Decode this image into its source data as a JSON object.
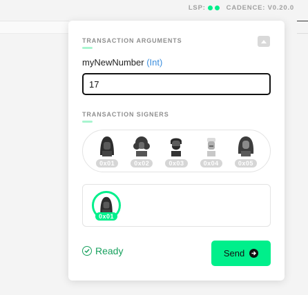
{
  "statusbar": {
    "lsp_label": "LSP:",
    "lsp_dots": [
      "#00ef8b",
      "#00ef8b"
    ],
    "version": "CADENCE: V0.20.0"
  },
  "arguments": {
    "title": "TRANSACTION ARGUMENTS",
    "param_name": "myNewNumber",
    "param_type": "(Int)",
    "value": "17"
  },
  "signers": {
    "title": "TRANSACTION SIGNERS",
    "accounts": [
      {
        "address": "0x01",
        "icon": "dark-hair-avatar-icon"
      },
      {
        "address": "0x02",
        "icon": "curly-hair-avatar-icon"
      },
      {
        "address": "0x03",
        "icon": "bearded-man-avatar-icon"
      },
      {
        "address": "0x04",
        "icon": "gray-avatar-icon"
      },
      {
        "address": "0x05",
        "icon": "long-hair-avatar-icon"
      }
    ],
    "selected": {
      "address": "0x01",
      "icon": "dark-hair-avatar-icon"
    }
  },
  "footer": {
    "status": "Ready",
    "send_label": "Send"
  },
  "colors": {
    "accent": "#00ef8b",
    "ready": "#17a05d",
    "type_blue": "#3a8dde"
  }
}
